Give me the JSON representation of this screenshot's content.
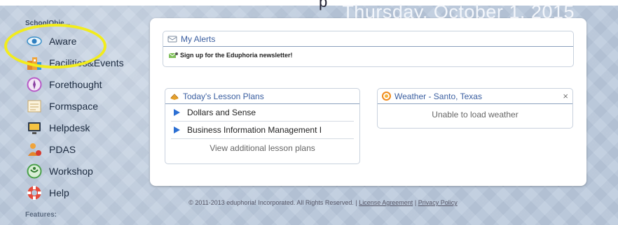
{
  "header": {
    "partial_title": "p",
    "date": "Thursday, October 1, 2015"
  },
  "sidebar": {
    "title": "SchoolObje...",
    "items": [
      {
        "label": "Aware",
        "icon": "eye-icon"
      },
      {
        "label": "Facilities&Events",
        "icon": "buildings-icon"
      },
      {
        "label": "Forethought",
        "icon": "compass-icon"
      },
      {
        "label": "Formspace",
        "icon": "form-icon"
      },
      {
        "label": "Helpdesk",
        "icon": "monitor-icon"
      },
      {
        "label": "PDAS",
        "icon": "person-icon"
      },
      {
        "label": "Workshop",
        "icon": "workshop-icon"
      },
      {
        "label": "Help",
        "icon": "lifebuoy-icon"
      }
    ],
    "features_label": "Features:"
  },
  "alerts": {
    "title": "My Alerts",
    "message": "Sign up for the Eduphoria newsletter!"
  },
  "lessons": {
    "title": "Today's Lesson Plans",
    "items": [
      "Dollars and Sense",
      "Business Information Management I"
    ],
    "more": "View additional lesson plans"
  },
  "weather": {
    "title": "Weather - Santo, Texas",
    "close": "×",
    "message": "Unable to load weather"
  },
  "footer": {
    "copyright": "© 2011-2013 eduphoria! Incorporated. All Rights Reserved. |",
    "license": "License Agreement",
    "separator": "|",
    "privacy": "Privacy Policy"
  },
  "colors": {
    "accent": "#3a5ea0",
    "highlight": "#f2ec1c",
    "background": "#b9c8db"
  }
}
